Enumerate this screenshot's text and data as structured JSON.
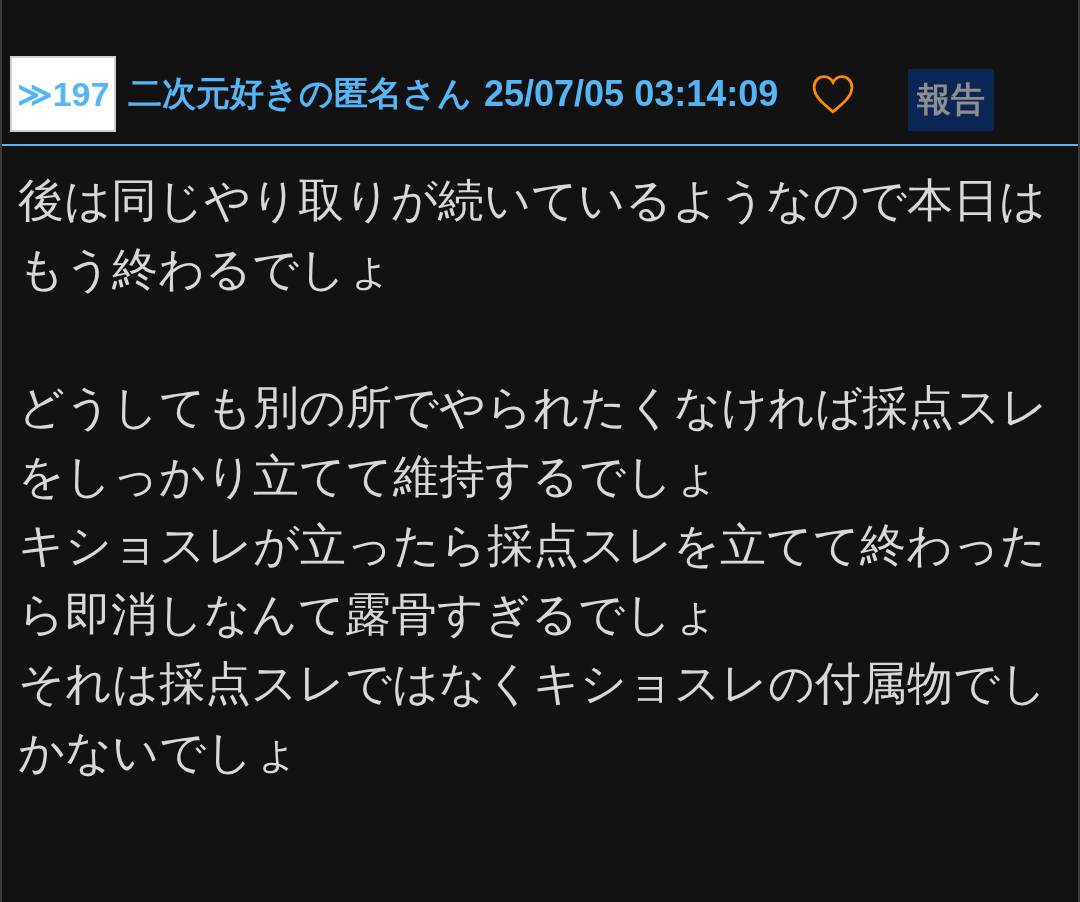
{
  "post": {
    "number": "≫197",
    "author": "二次元好きの匿名さん",
    "date": "25/07/05 03:14:09",
    "liked": false,
    "report_label": "報告",
    "paragraphs": [
      {
        "lines": [
          "後は同じやり取りが続いているようなので本日はもう終わるでしょ"
        ]
      },
      {
        "lines": [
          "どうしても別の所でやられたくなければ採点スレをしっかり立てて維持するでしょ",
          "キショスレが立ったら採点スレを立てて終わったら即消しなんて露骨すぎるでしょ",
          "それは採点スレではなくキショスレの付属物でしかないでしょ"
        ]
      }
    ]
  }
}
